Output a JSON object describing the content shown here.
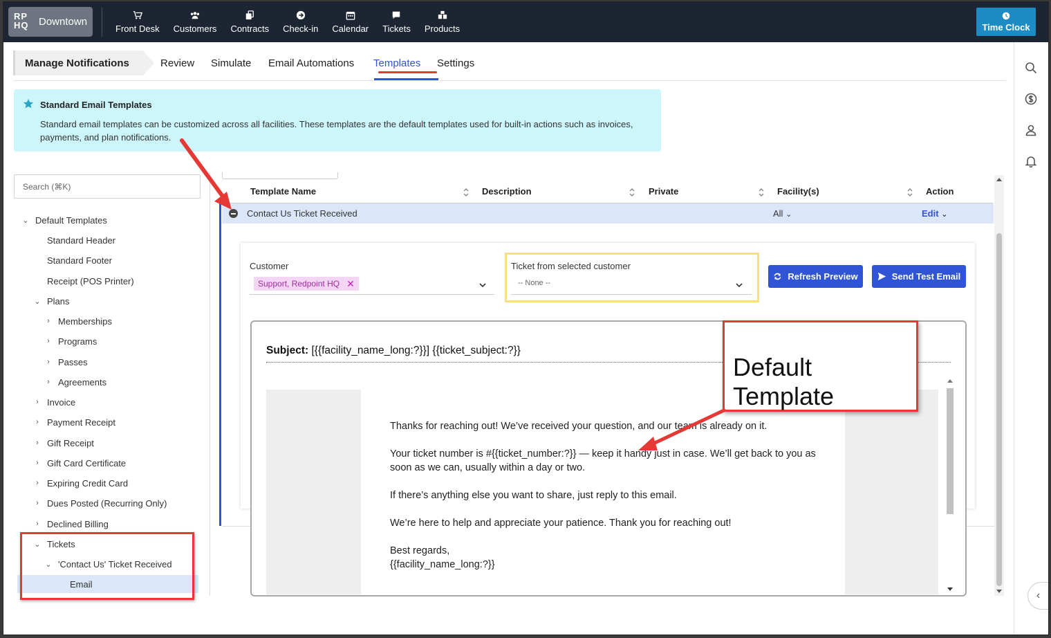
{
  "brand": {
    "logo": "RP HQ",
    "location": "Downtown"
  },
  "nav": [
    {
      "label": "Front Desk",
      "icon": "cart-icon"
    },
    {
      "label": "Customers",
      "icon": "users-icon"
    },
    {
      "label": "Contracts",
      "icon": "contracts-icon"
    },
    {
      "label": "Check-in",
      "icon": "arrow-circle-icon"
    },
    {
      "label": "Calendar",
      "icon": "calendar-icon"
    },
    {
      "label": "Tickets",
      "icon": "chat-icon"
    },
    {
      "label": "Products",
      "icon": "boxes-icon"
    }
  ],
  "time_clock": "Time Clock",
  "tabs": {
    "title": "Manage Notifications",
    "items": [
      "Review",
      "Simulate",
      "Email Automations",
      "Templates",
      "Settings"
    ],
    "active": "Templates"
  },
  "info": {
    "title": "Standard Email Templates",
    "body": "Standard email templates can be customized across all facilities. These templates are the default templates used for built-in actions such as invoices, payments, and plan notifications."
  },
  "search": {
    "placeholder": "Search (⌘K)"
  },
  "tree": {
    "root": "Default Templates",
    "standard_header": "Standard Header",
    "standard_footer": "Standard Footer",
    "receipt": "Receipt (POS Printer)",
    "plans": "Plans",
    "memberships": "Memberships",
    "programs": "Programs",
    "passes": "Passes",
    "agreements": "Agreements",
    "invoice": "Invoice",
    "payment_receipt": "Payment Receipt",
    "gift_receipt": "Gift Receipt",
    "gift_card": "Gift Card Certificate",
    "expiring_credit": "Expiring Credit Card",
    "dues_posted": "Dues Posted (Recurring Only)",
    "declined_billing": "Declined Billing",
    "tickets": "Tickets",
    "contact_us": "'Contact Us' Ticket Received",
    "email": "Email"
  },
  "table": {
    "headers": {
      "name": "Template Name",
      "description": "Description",
      "private": "Private",
      "facilities": "Facility(s)",
      "action": "Action"
    },
    "row": {
      "name": "Contact Us Ticket Received",
      "facilities": "All",
      "action": "Edit"
    }
  },
  "form": {
    "customer_label": "Customer",
    "customer_chip": "Support, Redpoint HQ",
    "ticket_label": "Ticket from selected customer",
    "ticket_value": "-- None --",
    "refresh": "Refresh Preview",
    "send": "Send Test Email"
  },
  "preview": {
    "subject_label": "Subject:",
    "subject_value": "[{{facility_name_long:?}}] {{ticket_subject:?}}",
    "p1": "Thanks for reaching out! We’ve received your question, and our team is already on it.",
    "p2": "Your ticket number is #{{ticket_number:?}} — keep it handy just in case. We’ll get back to you as soon as we can, usually within a day or two.",
    "p3": "If there’s anything else you want to share, just reply to this email.",
    "p4": "We’re here to help and appreciate your patience. Thank you for reaching out!",
    "sign1": "Best regards,",
    "sign2": "{{facility_name_long:?}}"
  },
  "annotation": {
    "callout": "Default Template"
  },
  "colors": {
    "topbar": "#1d2432",
    "accent": "#2f54d6",
    "info_bg": "#ccf6fb",
    "annotation": "#e53935",
    "time_clock": "#1e8cc4"
  }
}
